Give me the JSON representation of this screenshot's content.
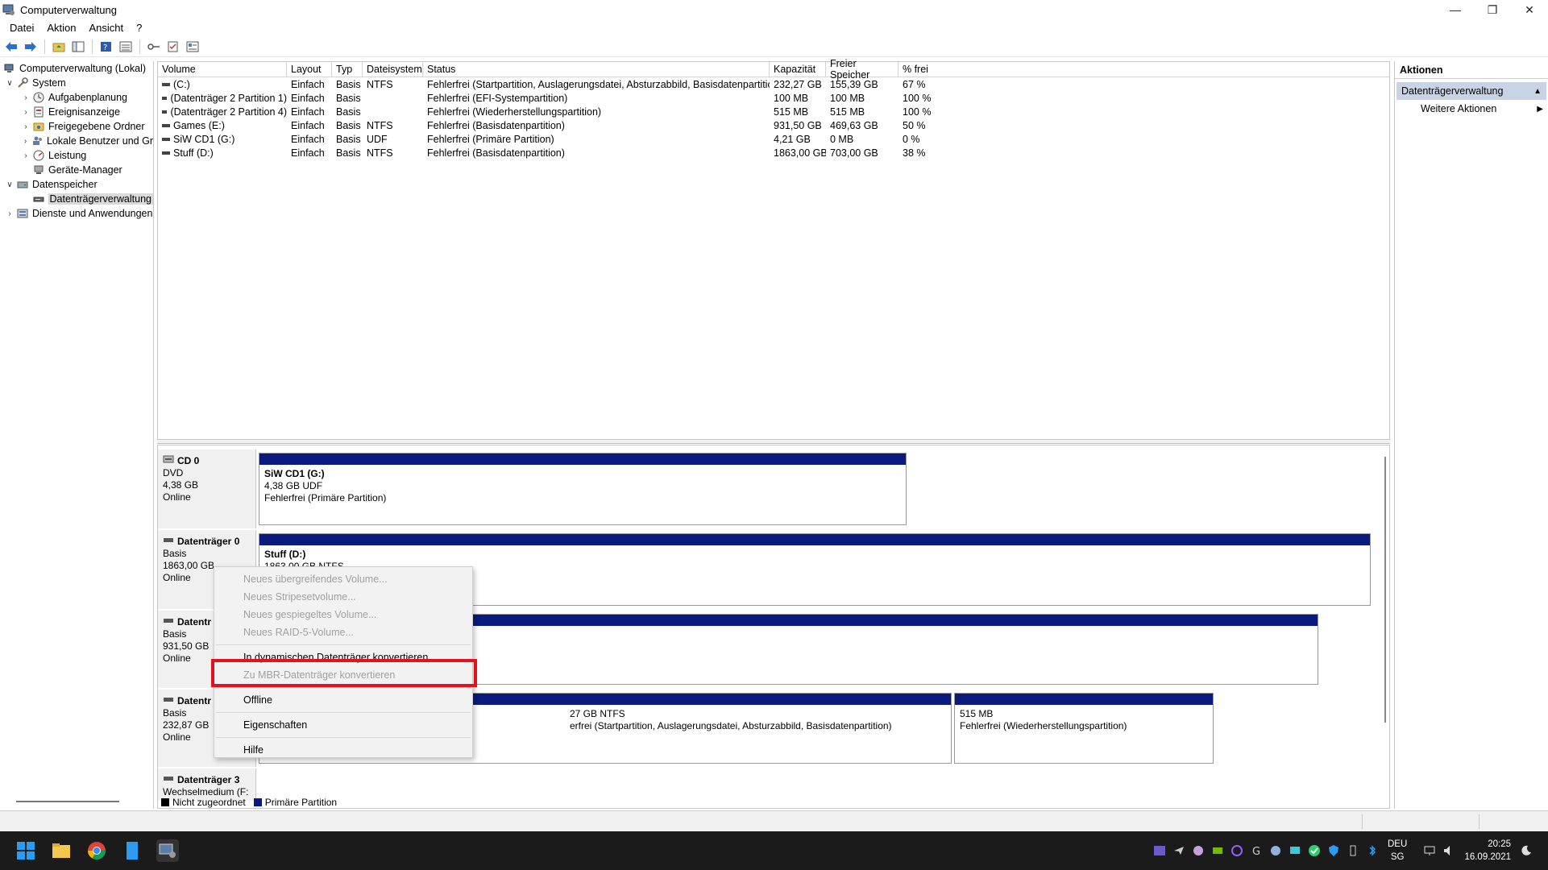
{
  "window": {
    "title": "Computerverwaltung"
  },
  "menu": [
    "Datei",
    "Aktion",
    "Ansicht",
    "?"
  ],
  "tree": {
    "root": "Computerverwaltung (Lokal)",
    "system": "System",
    "system_children": [
      "Aufgabenplanung",
      "Ereignisanzeige",
      "Freigegebene Ordner",
      "Lokale Benutzer und Gr",
      "Leistung",
      "Geräte-Manager"
    ],
    "storage": "Datenspeicher",
    "disk_mgmt": "Datenträgerverwaltung",
    "services": "Dienste und Anwendungen"
  },
  "volumes": {
    "headers": [
      "Volume",
      "Layout",
      "Typ",
      "Dateisystem",
      "Status",
      "Kapazität",
      "Freier Speicher",
      "% frei"
    ],
    "rows": [
      [
        "(C:)",
        "Einfach",
        "Basis",
        "NTFS",
        "Fehlerfrei (Startpartition, Auslagerungsdatei, Absturzabbild, Basisdatenpartition)",
        "232,27 GB",
        "155,39 GB",
        "67 %"
      ],
      [
        "(Datenträger 2 Partition 1)",
        "Einfach",
        "Basis",
        "",
        "Fehlerfrei (EFI-Systempartition)",
        "100 MB",
        "100 MB",
        "100 %"
      ],
      [
        "(Datenträger 2 Partition 4)",
        "Einfach",
        "Basis",
        "",
        "Fehlerfrei (Wiederherstellungspartition)",
        "515 MB",
        "515 MB",
        "100 %"
      ],
      [
        "Games (E:)",
        "Einfach",
        "Basis",
        "NTFS",
        "Fehlerfrei (Basisdatenpartition)",
        "931,50 GB",
        "469,63 GB",
        "50 %"
      ],
      [
        "SiW CD1 (G:)",
        "Einfach",
        "Basis",
        "UDF",
        "Fehlerfrei (Primäre Partition)",
        "4,21 GB",
        "0 MB",
        "0 %"
      ],
      [
        "Stuff (D:)",
        "Einfach",
        "Basis",
        "NTFS",
        "Fehlerfrei (Basisdatenpartition)",
        "1863,00 GB",
        "703,00 GB",
        "38 %"
      ]
    ]
  },
  "disks": {
    "cd0": {
      "name": "CD 0",
      "type": "DVD",
      "size": "4,38 GB",
      "state": "Online",
      "part_name": "SiW CD1  (G:)",
      "part_size": "4,38 GB UDF",
      "part_status": "Fehlerfrei (Primäre Partition)"
    },
    "d0": {
      "name": "Datenträger 0",
      "type": "Basis",
      "size": "1863,00 GB",
      "state": "Online",
      "part_name": "Stuff  (D:)",
      "part_size": "1863,00 GB NTFS"
    },
    "d1": {
      "name": "Datentr",
      "type": "Basis",
      "size": "931,50 GB",
      "state": "Online"
    },
    "d2": {
      "name": "Datentr",
      "type": "Basis",
      "size": "232,87 GB",
      "state": "Online",
      "part_c_size": "27 GB NTFS",
      "part_c_status": "erfrei (Startpartition, Auslagerungsdatei, Absturzabbild, Basisdatenpartition)",
      "part_r_size": "515 MB",
      "part_r_status": "Fehlerfrei (Wiederherstellungspartition)"
    },
    "d3": {
      "name": "Datenträger 3",
      "type": "Wechselmedium (F:"
    }
  },
  "legend": {
    "unallocated": "Nicht zugeordnet",
    "primary": "Primäre Partition",
    "unallocated_color": "#000000",
    "primary_color": "#0a1a7e"
  },
  "actions": {
    "header": "Aktionen",
    "sub": "Datenträgerverwaltung",
    "more": "Weitere Aktionen"
  },
  "context_menu": {
    "items": [
      {
        "label": "Neues übergreifendes Volume...",
        "disabled": true
      },
      {
        "label": "Neues Stripesetvolume...",
        "disabled": true
      },
      {
        "label": "Neues gespiegeltes Volume...",
        "disabled": true
      },
      {
        "label": "Neues RAID-5-Volume...",
        "disabled": true
      },
      {
        "label": "In dynamischen Datenträger konvertieren...",
        "disabled": false
      },
      {
        "label": "Zu MBR-Datenträger konvertieren",
        "disabled": true
      },
      {
        "label": "Offline",
        "disabled": false
      },
      {
        "label": "Eigenschaften",
        "disabled": false
      },
      {
        "label": "Hilfe",
        "disabled": false
      }
    ],
    "highlight_color": "#e0141e"
  },
  "taskbar": {
    "lang_1": "DEU",
    "lang_2": "SG",
    "time": "20:25",
    "date": "16.09.2021"
  }
}
